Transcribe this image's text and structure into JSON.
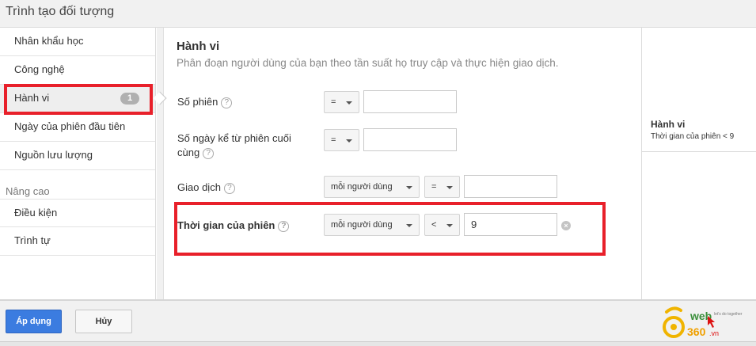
{
  "header": {
    "title": "Trình tạo đối tượng"
  },
  "sidebar": {
    "items": [
      {
        "label": "Nhân khẩu học"
      },
      {
        "label": "Công nghệ"
      },
      {
        "label": "Hành vi",
        "badge": "1"
      },
      {
        "label": "Ngày của phiên đầu tiên"
      },
      {
        "label": "Nguồn lưu lượng"
      }
    ],
    "advanced_heading": "Nâng cao",
    "advanced_items": [
      {
        "label": "Điều kiện"
      },
      {
        "label": "Trình tự"
      }
    ]
  },
  "main": {
    "title": "Hành vi",
    "description": "Phân đoạn người dùng của bạn theo tần suất họ truy cập và thực hiện giao dịch.",
    "rows": [
      {
        "label": "Số phiên",
        "operator": "=",
        "value": ""
      },
      {
        "label": "Số ngày kể từ phiên cuối cùng",
        "operator": "=",
        "value": ""
      },
      {
        "label": "Giao dịch",
        "scope": "mỗi người dùng",
        "operator": "=",
        "value": ""
      },
      {
        "label": "Thời gian của phiên",
        "scope": "mỗi người dùng",
        "operator": "<",
        "value": "9"
      }
    ],
    "help_symbol": "?",
    "clear_symbol": "×"
  },
  "summary": {
    "title": "Hành vi",
    "value": "Thời gian của phiên < 9"
  },
  "footer": {
    "apply_label": "Áp dụng",
    "cancel_label": "Hủy"
  },
  "logo": {
    "brand": "web",
    "number": "360",
    "suffix": ".vn",
    "tagline": "let's do together"
  },
  "colors": {
    "highlight": "#e8202a",
    "primary_button": "#3b7ce0",
    "badge": "#b0b0b0"
  }
}
